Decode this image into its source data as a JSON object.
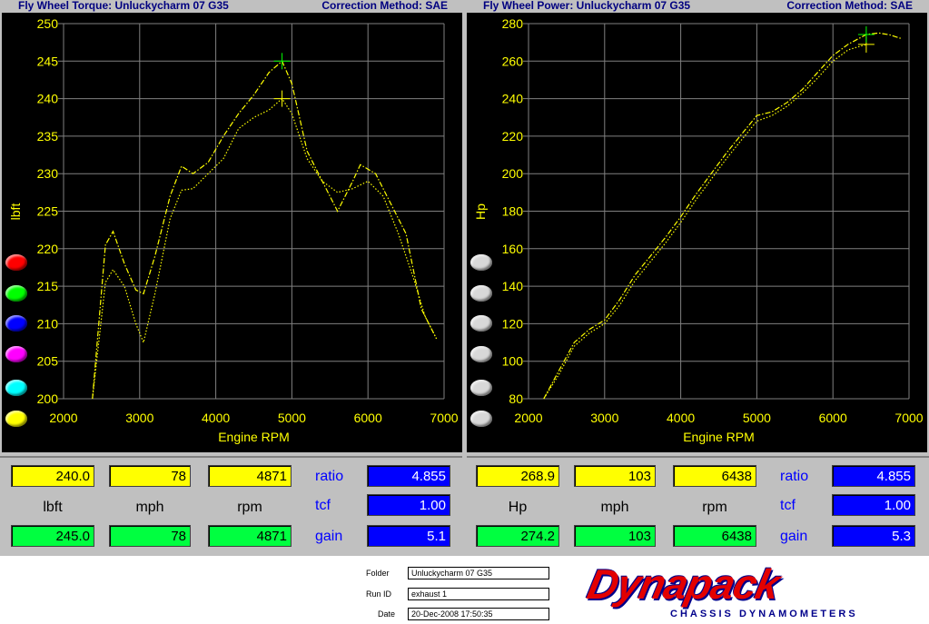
{
  "left": {
    "title": "Fly Wheel Torque: Unluckycharm 07 G35",
    "correction": "Correction Method: SAE",
    "readout": {
      "yellow": [
        "240.0",
        "78",
        "4871"
      ],
      "units": [
        "lbft",
        "mph",
        "rpm"
      ],
      "green": [
        "245.0",
        "78",
        "4871"
      ],
      "ratio_label": "ratio",
      "ratio": "4.855",
      "tcf_label": "tcf",
      "tcf": "1.00",
      "gain_label": "gain",
      "gain": "5.1"
    }
  },
  "right": {
    "title": "Fly Wheel Power: Unluckycharm 07 G35",
    "correction": "Correction Method: SAE",
    "readout": {
      "yellow": [
        "268.9",
        "103",
        "6438"
      ],
      "units": [
        "Hp",
        "mph",
        "rpm"
      ],
      "green": [
        "274.2",
        "103",
        "6438"
      ],
      "ratio_label": "ratio",
      "ratio": "4.855",
      "tcf_label": "tcf",
      "tcf": "1.00",
      "gain_label": "gain",
      "gain": "5.3"
    }
  },
  "color_buttons": [
    "#ff0000",
    "#00ff00",
    "#0000ff",
    "#ff00ff",
    "#00ffff",
    "#ffff00"
  ],
  "footer": {
    "folder_label": "Folder",
    "folder": "Unluckycharm 07 G35",
    "runid_label": "Run ID",
    "runid": "exhaust 1",
    "date_label": "Date",
    "date": "20-Dec-2008  17:50:35",
    "logo": "Dynapack",
    "logo_sub": "CHASSIS DYNAMOMETERS"
  },
  "chart_data": [
    {
      "type": "line",
      "ylabel": "lbft",
      "xlabel": "Engine RPM",
      "xlim": [
        2000,
        7000
      ],
      "ylim": [
        200,
        250
      ],
      "xticks": [
        2000,
        3000,
        4000,
        5000,
        6000,
        7000
      ],
      "yticks": [
        200,
        205,
        210,
        215,
        220,
        225,
        230,
        235,
        240,
        245,
        250
      ],
      "grid": true,
      "cursor": {
        "x": 4871,
        "y1": 240.0,
        "y2": 245.0
      },
      "series": [
        {
          "color": "#ffff00",
          "style": "dotted",
          "x": [
            2380,
            2550,
            2650,
            2800,
            2950,
            3050,
            3200,
            3400,
            3550,
            3700,
            3900,
            4100,
            4300,
            4500,
            4700,
            4871,
            5000,
            5200,
            5400,
            5600,
            5800,
            6000,
            6200,
            6400,
            6600,
            6750,
            6900
          ],
          "y": [
            200,
            215.5,
            217.2,
            215,
            210,
            207.5,
            214,
            224,
            227.8,
            228,
            230,
            232,
            236,
            237.5,
            238.5,
            240,
            238,
            232,
            229,
            227.5,
            228,
            229,
            227,
            222,
            216,
            211,
            208
          ]
        },
        {
          "color": "#ffff00",
          "style": "dashed",
          "x": [
            2380,
            2550,
            2650,
            2800,
            2950,
            3050,
            3200,
            3400,
            3550,
            3700,
            3900,
            4100,
            4300,
            4500,
            4700,
            4871,
            5000,
            5200,
            5400,
            5600,
            5800,
            5900,
            6100,
            6300,
            6500,
            6700,
            6900
          ],
          "y": [
            200,
            220.5,
            222.3,
            218,
            214.5,
            214,
            219,
            227,
            231,
            230,
            231.5,
            235,
            238,
            240.5,
            243.5,
            245,
            242,
            233,
            229,
            225,
            229,
            231.2,
            230,
            226,
            222,
            212,
            208
          ]
        }
      ]
    },
    {
      "type": "line",
      "ylabel": "Hp",
      "xlabel": "Engine RPM",
      "xlim": [
        2000,
        7000
      ],
      "ylim": [
        80,
        280
      ],
      "xticks": [
        2000,
        3000,
        4000,
        5000,
        6000,
        7000
      ],
      "yticks": [
        80,
        100,
        120,
        140,
        160,
        180,
        200,
        220,
        240,
        260,
        280
      ],
      "grid": true,
      "cursor": {
        "x": 6438,
        "y1": 268.9,
        "y2": 274.2
      },
      "series": [
        {
          "color": "#ffff00",
          "style": "dotted",
          "x": [
            2200,
            2400,
            2600,
            2800,
            3000,
            3200,
            3400,
            3600,
            3800,
            4000,
            4200,
            4400,
            4600,
            4800,
            5000,
            5200,
            5400,
            5600,
            5800,
            6000,
            6200,
            6438
          ],
          "y": [
            80,
            93,
            108,
            115,
            120,
            130,
            143,
            153,
            163,
            174,
            186,
            197,
            208,
            218,
            228,
            231,
            236,
            243,
            251,
            260,
            266,
            268.9
          ]
        },
        {
          "color": "#ffff00",
          "style": "dashed",
          "x": [
            2200,
            2400,
            2600,
            2800,
            3000,
            3200,
            3400,
            3600,
            3800,
            4000,
            4200,
            4400,
            4600,
            4800,
            5000,
            5200,
            5400,
            5600,
            5800,
            6000,
            6200,
            6438,
            6600,
            6750,
            6900
          ],
          "y": [
            80,
            95,
            110,
            117,
            122,
            133,
            146,
            156,
            166,
            177,
            189,
            200,
            211,
            221,
            231,
            233,
            238,
            245,
            254,
            263,
            269,
            274.2,
            275,
            274,
            272
          ]
        }
      ]
    }
  ]
}
